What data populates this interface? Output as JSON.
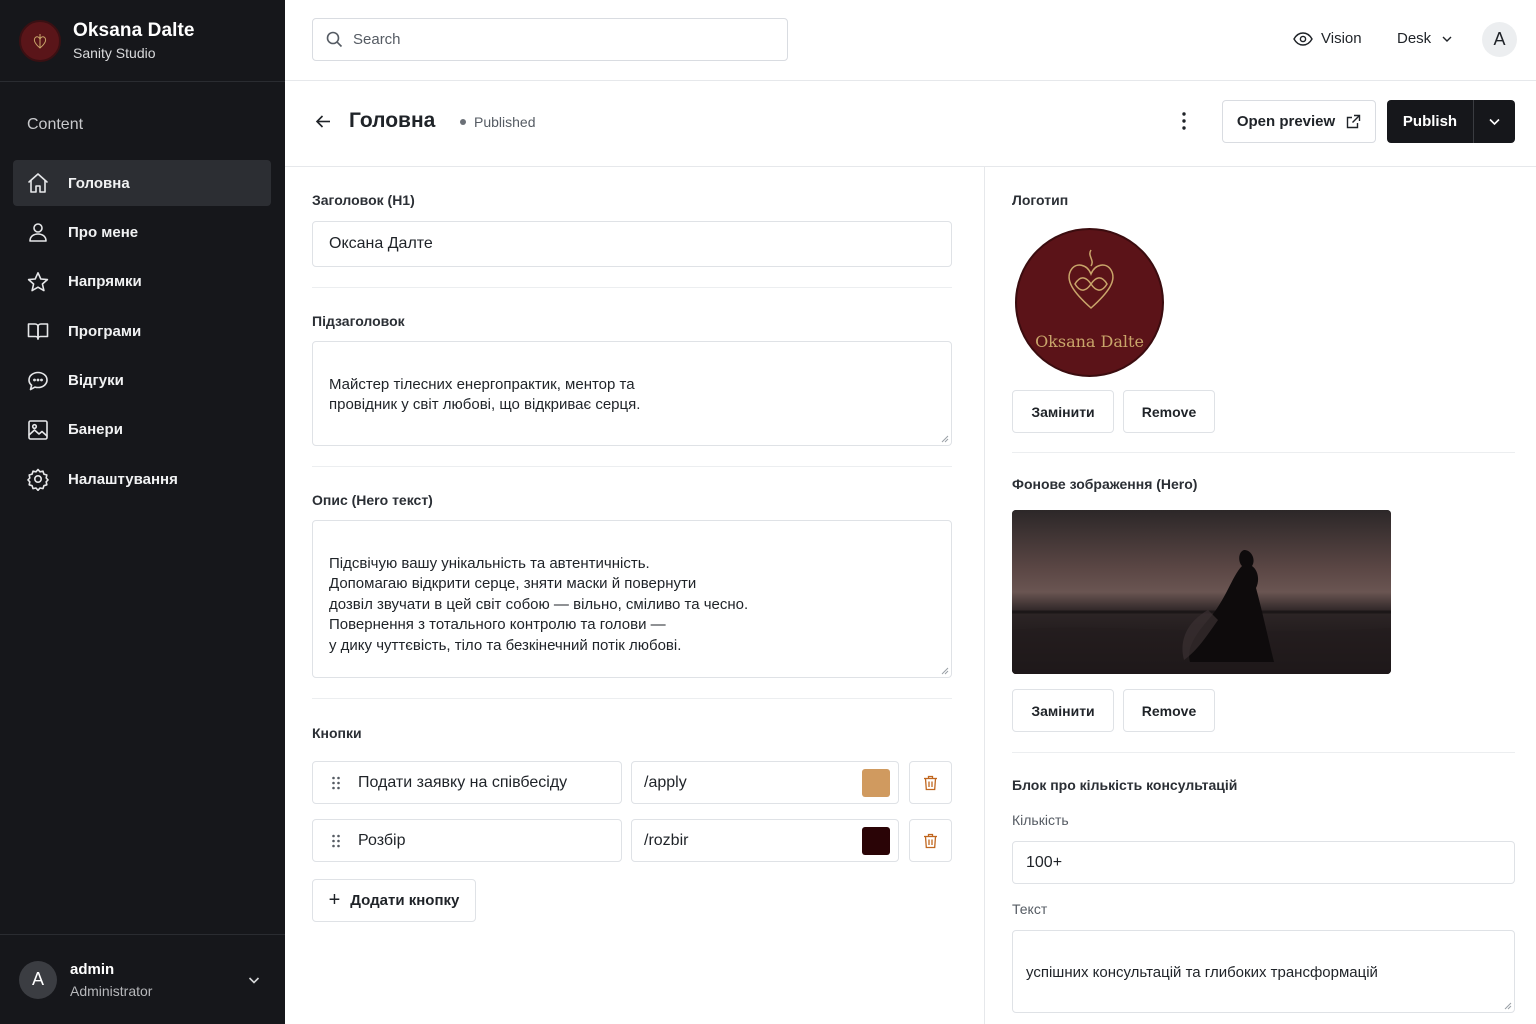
{
  "app": {
    "name": "Oksana Dalte",
    "subtitle": "Sanity Studio"
  },
  "sidebar": {
    "section": "Content",
    "items": [
      {
        "label": "Головна",
        "icon": "home-icon",
        "active": true
      },
      {
        "label": "Про мене",
        "icon": "user-icon"
      },
      {
        "label": "Напрямки",
        "icon": "star-icon"
      },
      {
        "label": "Програми",
        "icon": "book-icon"
      },
      {
        "label": "Відгуки",
        "icon": "comment-icon"
      },
      {
        "label": "Банери",
        "icon": "image-icon"
      },
      {
        "label": "Налаштування",
        "icon": "gear-icon"
      }
    ],
    "user": {
      "initial": "A",
      "name": "admin",
      "role": "Administrator"
    }
  },
  "topbar": {
    "search_placeholder": "Search",
    "vision": "Vision",
    "desk": "Desk",
    "avatar_initial": "A"
  },
  "document": {
    "title": "Головна",
    "status": "Published",
    "open_preview": "Open preview",
    "publish": "Publish"
  },
  "form": {
    "h1_label": "Заголовок (H1)",
    "h1_value": "Оксана Далте",
    "subtitle_label": "Підзаголовок",
    "subtitle_value": "Майстер тілесних енергопрактик, ментор та\nпровідник у світ любові, що відкриває серця.",
    "description_label": "Опис (Hero текст)",
    "description_value": "Підсвічую вашу унікальність та автентичність.\nДопомагаю відкрити серце, зняти маски й повернути\nдозвіл звучати в цей світ собою — вільно, сміливо та чесно.\nПовернення з тотального контролю та голови —\nу дику чуттєвість, тіло та безкінечний потік любові.",
    "buttons_label": "Кнопки",
    "buttons": [
      {
        "label": "Подати заявку на співбесіду",
        "url": "/apply",
        "color": "#d09a5f"
      },
      {
        "label": "Розбір",
        "url": "/rozbir",
        "color": "#2a0406"
      }
    ],
    "add_button": "Додати кнопку"
  },
  "right": {
    "logo_label": "Логотип",
    "logo_text": "Oksana Dalte",
    "replace": "Замінити",
    "remove": "Remove",
    "hero_label": "Фонове зображення (Hero)",
    "consult_label": "Блок про кількість консультацій",
    "count_label": "Кількість",
    "count_value": "100+",
    "text_label": "Текст",
    "text_value": "успішних консультацій та глибоких трансформацій"
  }
}
